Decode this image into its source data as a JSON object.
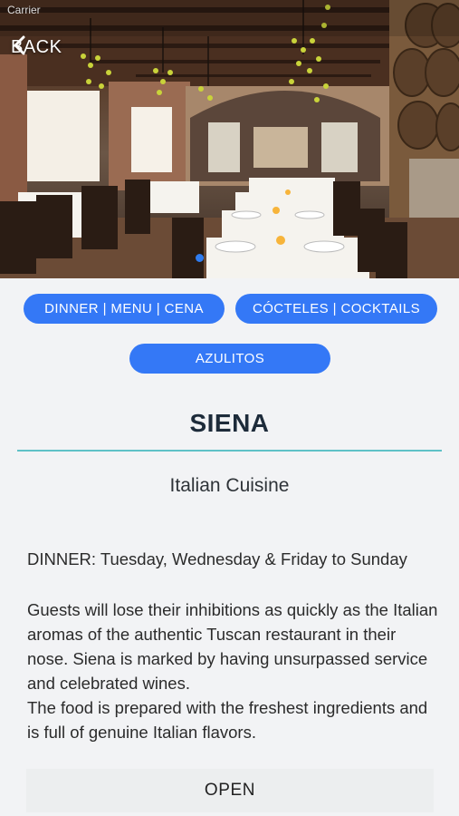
{
  "status_bar": {
    "carrier": "Carrier"
  },
  "header": {
    "back_label": "BACK"
  },
  "nav_buttons": [
    {
      "label": "DINNER | MENU | CENA"
    },
    {
      "label": "CÓCTELES | COCKTAILS"
    },
    {
      "label": "AZULITOS"
    }
  ],
  "restaurant": {
    "name": "SIENA",
    "cuisine": "Italian Cuisine",
    "schedule": "DINNER: Tuesday, Wednesday & Friday to Sunday",
    "description_1": "Guests will lose their inhibitions as quickly as the Italian aromas of the authentic Tuscan restaurant in their nose. Siena is marked by having unsurpassed service and celebrated wines.",
    "description_2": "The food is prepared with the freshest ingredients and is full of genuine Italian flavors."
  },
  "actions": {
    "open_label": "OPEN"
  },
  "colors": {
    "accent": "#3478f6",
    "divider": "#5fc1c7",
    "background": "#f2f3f5"
  }
}
